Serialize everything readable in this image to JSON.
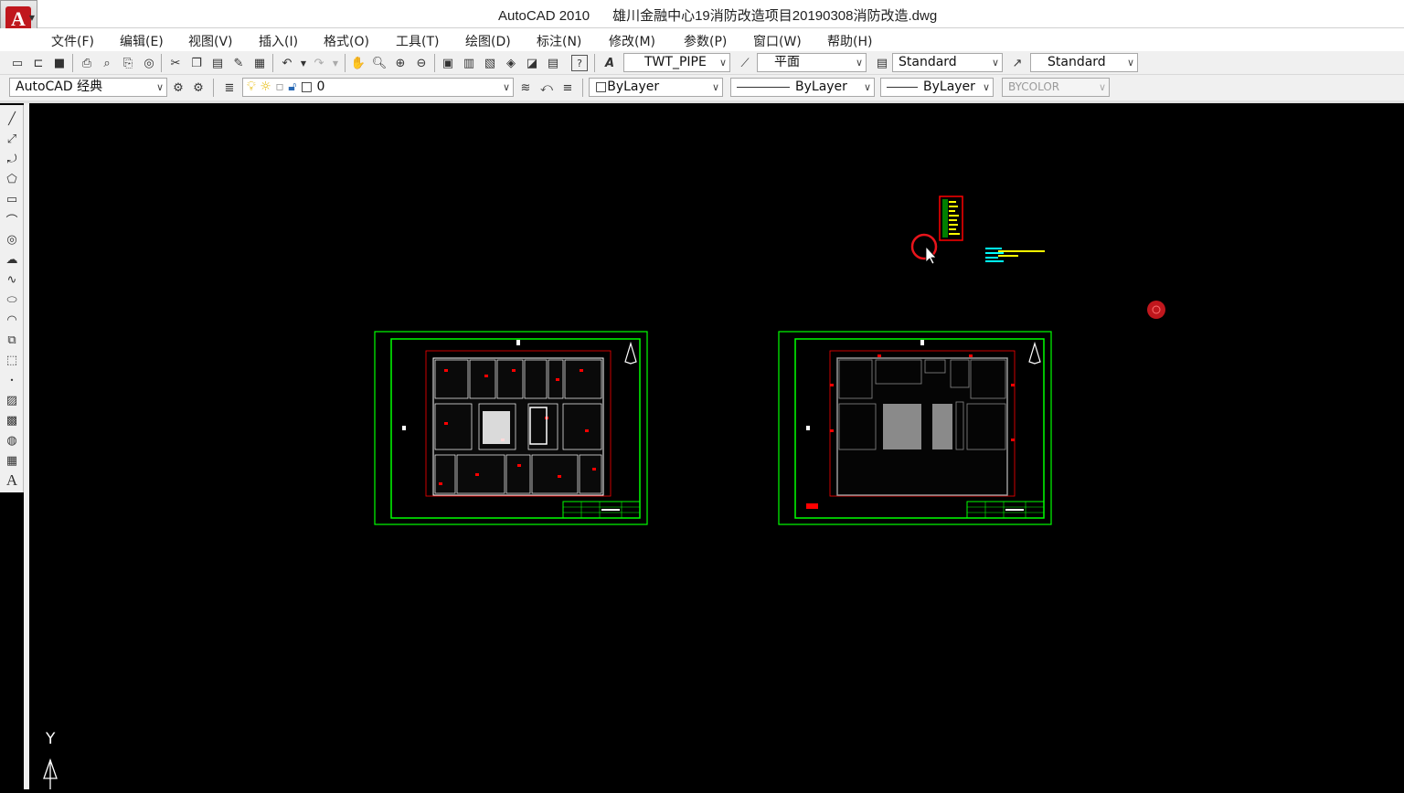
{
  "window": {
    "app_name": "AutoCAD 2010",
    "file_name": "雄川金融中心19消防改造项目20190308消防改造.dwg",
    "title": "AutoCAD 2010      雄川金融中心19消防改造项目20190308消防改造.dwg"
  },
  "app_button": {
    "logo_letter": "A"
  },
  "menu": [
    {
      "label": "文件(F)"
    },
    {
      "label": "编辑(E)"
    },
    {
      "label": "视图(V)"
    },
    {
      "label": "插入(I)"
    },
    {
      "label": "格式(O)"
    },
    {
      "label": "工具(T)"
    },
    {
      "label": "绘图(D)"
    },
    {
      "label": "标注(N)"
    },
    {
      "label": "修改(M)"
    },
    {
      "label": "参数(P)"
    },
    {
      "label": "窗口(W)"
    },
    {
      "label": "帮助(H)"
    }
  ],
  "toolbar1": {
    "text_style": "TWT_PIPE",
    "dim_style": "平面",
    "table_style": "Standard",
    "multileader_style": "Standard"
  },
  "toolbar2": {
    "workspace": "AutoCAD 经典",
    "layer": "0",
    "color": "ByLayer",
    "linetype": "ByLayer",
    "lineweight": "ByLayer",
    "plotstyle": "BYCOLOR"
  },
  "ucs": {
    "y_label": "Y"
  },
  "colors": {
    "red": "#ff0000",
    "green": "#00ff00",
    "white": "#ffffff",
    "yellow": "#ffff00",
    "cyan": "#00ffff",
    "marker_red": "#e8141b"
  },
  "icons": {
    "std": [
      "new-icon",
      "open-icon",
      "save-icon",
      "print-icon",
      "preview-icon",
      "publish-icon",
      "3dprint-icon",
      "cut-icon",
      "copy-icon",
      "paste-icon",
      "matchprop-icon",
      "blockeditor-icon",
      "undo-icon",
      "redo-icon",
      "pan-icon",
      "zoom-realtime-icon",
      "zoom-window-icon",
      "zoom-previous-icon",
      "properties-icon",
      "designcenter-icon",
      "toolpalette-icon",
      "sheetset-icon",
      "markup-icon",
      "calculator-icon",
      "help-icon"
    ],
    "draw": [
      "line-icon",
      "xline-icon",
      "polyline-icon",
      "polygon-icon",
      "rectangle-icon",
      "arc-icon",
      "circle-icon",
      "revcloud-icon",
      "spline-icon",
      "ellipse-icon",
      "ellipse-arc-icon",
      "insert-block-icon",
      "make-block-icon",
      "point-icon",
      "hatch-icon",
      "gradient-icon",
      "region-icon",
      "table-icon",
      "mtext-icon"
    ]
  }
}
